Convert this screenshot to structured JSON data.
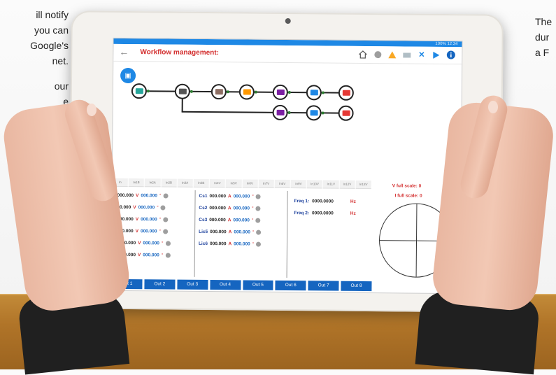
{
  "background_text": {
    "left_lines": [
      "ill notify",
      "you  can",
      "Google's",
      "net.",
      "our",
      "e"
    ],
    "right_lines": [
      "The",
      "dur",
      "a  F"
    ]
  },
  "tablet": {
    "status": "100% 12:34",
    "app": {
      "title": "Workflow management:",
      "icons": [
        "home-icon",
        "globe-icon",
        "warning-icon",
        "folder-icon",
        "close-icon",
        "play-icon",
        "info-icon"
      ]
    },
    "workflow": {
      "nodes": [
        {
          "name": "source",
          "color": "#26a69a"
        },
        {
          "name": "analyzer",
          "color": "#555555"
        },
        {
          "name": "filter",
          "color": "#8d6e63"
        },
        {
          "name": "config",
          "color": "#ff9800"
        },
        {
          "name": "module-a",
          "color": "#7b1fa2"
        },
        {
          "name": "module-b",
          "color": "#1e88e5"
        },
        {
          "name": "output-a",
          "color": "#e53935"
        },
        {
          "name": "module-c",
          "color": "#7b1fa2"
        },
        {
          "name": "module-d",
          "color": "#1e88e5"
        },
        {
          "name": "output-b",
          "color": "#e53935"
        }
      ]
    },
    "tabs": [
      "In",
      "In1B",
      "In2A",
      "In2B",
      "In3A",
      "In3B",
      "In4V",
      "In5V",
      "In6V",
      "In7V",
      "In8V",
      "In9V",
      "In10V",
      "In11V",
      "In12V",
      "In13V"
    ],
    "voltages": [
      {
        "label": "",
        "value": "000.000",
        "unit": "V",
        "angle": "000.000",
        "deg": "°"
      },
      {
        "label": "",
        "value": "00.000",
        "unit": "V",
        "angle": "000.000",
        "deg": "°"
      },
      {
        "label": "",
        "value": "000.000",
        "unit": "V",
        "angle": "000.000",
        "deg": "°"
      },
      {
        "label": "",
        "value": "000.000",
        "unit": "V",
        "angle": "000.000",
        "deg": "°"
      },
      {
        "label": "2",
        "value": "000.000",
        "unit": "V",
        "angle": "000.000",
        "deg": "°"
      },
      {
        "label": "3",
        "value": "000.000",
        "unit": "V",
        "angle": "000.000",
        "deg": "°"
      }
    ],
    "currents": [
      {
        "label": "Cs1",
        "value": "000.000",
        "unit": "A",
        "angle": "000.000",
        "deg": "°"
      },
      {
        "label": "Cs2",
        "value": "000.000",
        "unit": "A",
        "angle": "000.000",
        "deg": "°"
      },
      {
        "label": "Cs3",
        "value": "000.000",
        "unit": "A",
        "angle": "000.000",
        "deg": "°"
      },
      {
        "label": "Lic5",
        "value": "000.000",
        "unit": "A",
        "angle": "000.000",
        "deg": "°"
      },
      {
        "label": "Lic6",
        "value": "000.000",
        "unit": "A",
        "angle": "000.000",
        "deg": "°"
      }
    ],
    "freq": [
      {
        "label": "Freq 1:",
        "value": "0000.0000",
        "unit": "Hz"
      },
      {
        "label": "Freq 2:",
        "value": "0000.0000",
        "unit": "Hz"
      }
    ],
    "scale": {
      "v_full": "V full scale: 0",
      "i_full": "I full scale: 0"
    },
    "outputs": [
      "Out 1",
      "Out 2",
      "Out 3",
      "Out 4",
      "Out 5",
      "Out 6",
      "Out 7",
      "Out 8"
    ]
  }
}
